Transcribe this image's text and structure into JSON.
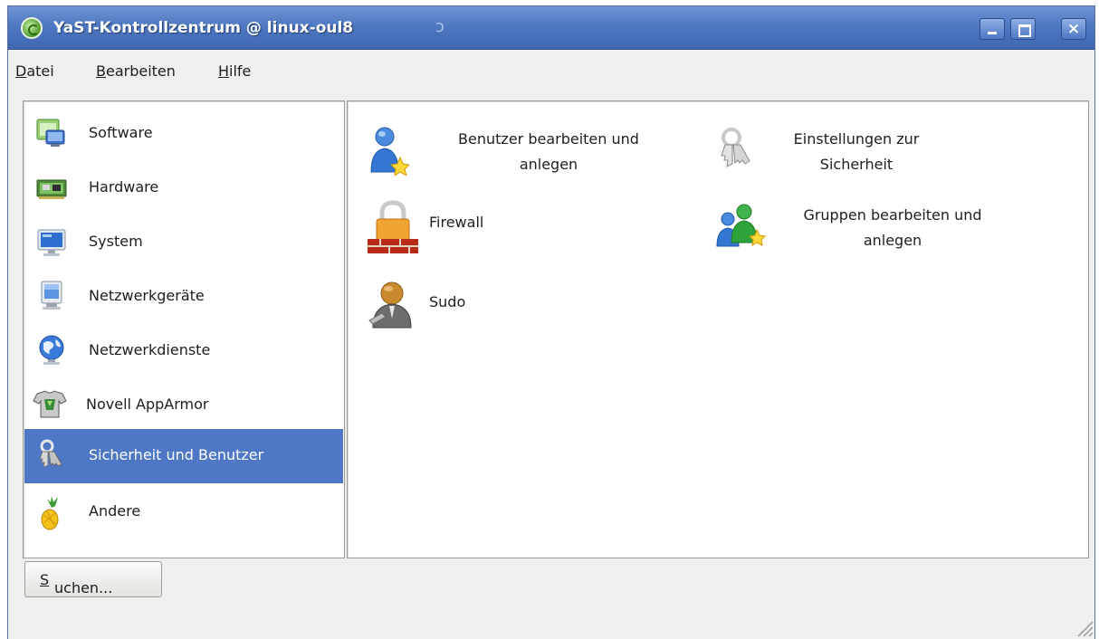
{
  "window": {
    "title": "YaST-Kontrollzentrum @ linux-oul8",
    "close_glyph": "×"
  },
  "menubar": {
    "items": [
      {
        "label": "Datei",
        "mnemonic": "D",
        "rest": "atei"
      },
      {
        "label": "Bearbeiten",
        "mnemonic": "B",
        "rest": "earbeiten"
      },
      {
        "label": "Hilfe",
        "mnemonic": "H",
        "rest": "ilfe"
      }
    ]
  },
  "sidebar": {
    "selected": "Sicherheit und Benutzer",
    "items": [
      {
        "label": "Software",
        "icon": "software-icon"
      },
      {
        "label": "Hardware",
        "icon": "hardware-icon"
      },
      {
        "label": "System",
        "icon": "system-icon"
      },
      {
        "label": "Netzwerkgeräte",
        "icon": "network-devices-icon"
      },
      {
        "label": "Netzwerkdienste",
        "icon": "network-services-icon"
      },
      {
        "label": "Novell AppArmor",
        "icon": "apparmor-icon"
      },
      {
        "label": "Sicherheit und Benutzer",
        "icon": "keys-icon"
      },
      {
        "label": "Andere",
        "icon": "pineapple-icon"
      }
    ]
  },
  "modules": [
    {
      "line1": "Benutzer bearbeiten und",
      "line2": "anlegen",
      "icon": "user-add-icon"
    },
    {
      "line1": "Einstellungen zur",
      "line2": "Sicherheit",
      "icon": "security-keys-icon"
    },
    {
      "line1": "Firewall",
      "line2": "",
      "icon": "firewall-lock-icon"
    },
    {
      "line1": "Gruppen bearbeiten und",
      "line2": "anlegen",
      "icon": "group-add-icon"
    },
    {
      "line1": "Sudo",
      "line2": "",
      "icon": "sudo-icon"
    }
  ],
  "search_button": {
    "mnemonic": "S",
    "rest": "uchen..."
  },
  "colors": {
    "titlebar": "#4f78c2",
    "selection": "#4e78c6",
    "window_bg": "#efefed"
  }
}
